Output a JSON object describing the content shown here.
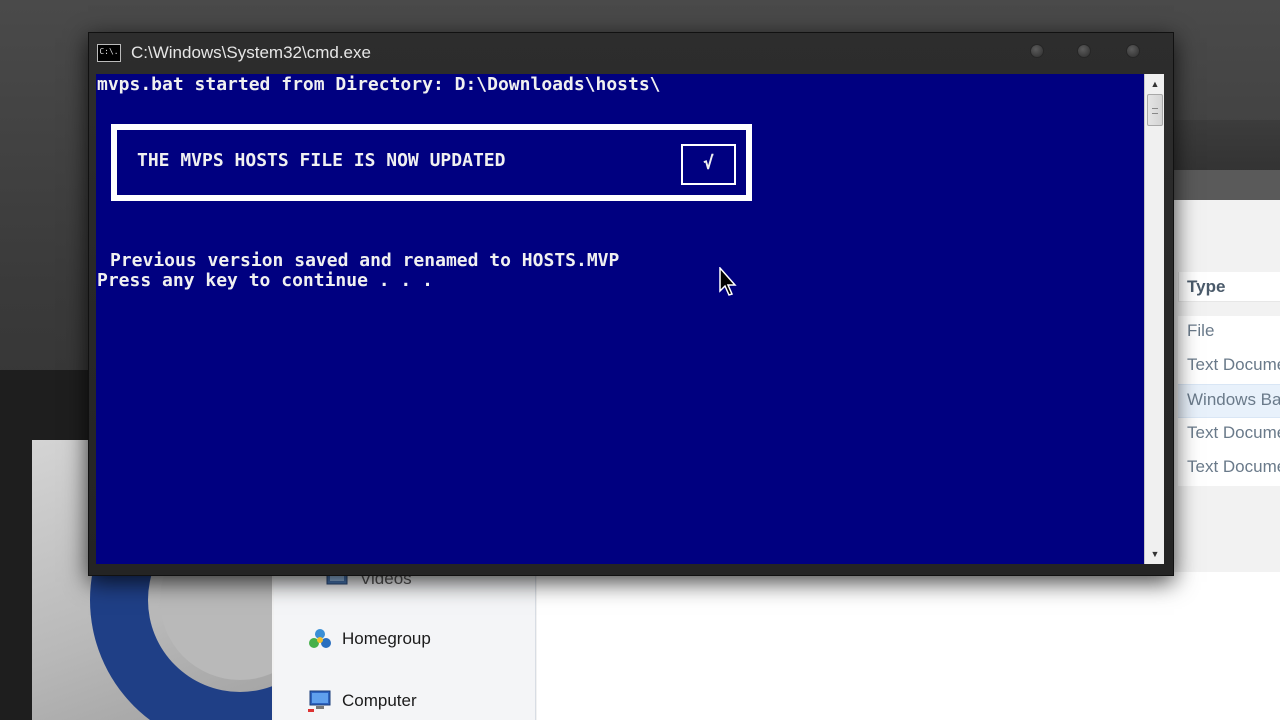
{
  "cmd": {
    "title": "C:\\Windows\\System32\\cmd.exe",
    "app_icon_text": "C:\\.",
    "lines": [
      "mvps.bat started from Directory: D:\\Downloads\\hosts\\",
      "Previous version saved and renamed to HOSTS.MVP",
      "Press any key to continue . . ."
    ],
    "banner": {
      "text": "THE MVPS HOSTS FILE IS NOW UPDATED",
      "check": "√"
    }
  },
  "explorer": {
    "column_header": "Type",
    "type_rows": [
      "File",
      "Text Document",
      "Windows Batch File",
      "Text Document",
      "Text Document"
    ],
    "selected_row_index": 2,
    "nav_items": [
      "Videos",
      "Homegroup",
      "Computer"
    ]
  },
  "colors": {
    "console_bg": "#000080",
    "console_text": "#f0f0f0",
    "logo_blue": "#1f3f86"
  },
  "icons": [
    "cmd-app-icon",
    "minimize-icon",
    "maximize-icon",
    "close-icon",
    "videos-icon",
    "homegroup-icon",
    "computer-icon",
    "mouse-pointer-icon"
  ]
}
